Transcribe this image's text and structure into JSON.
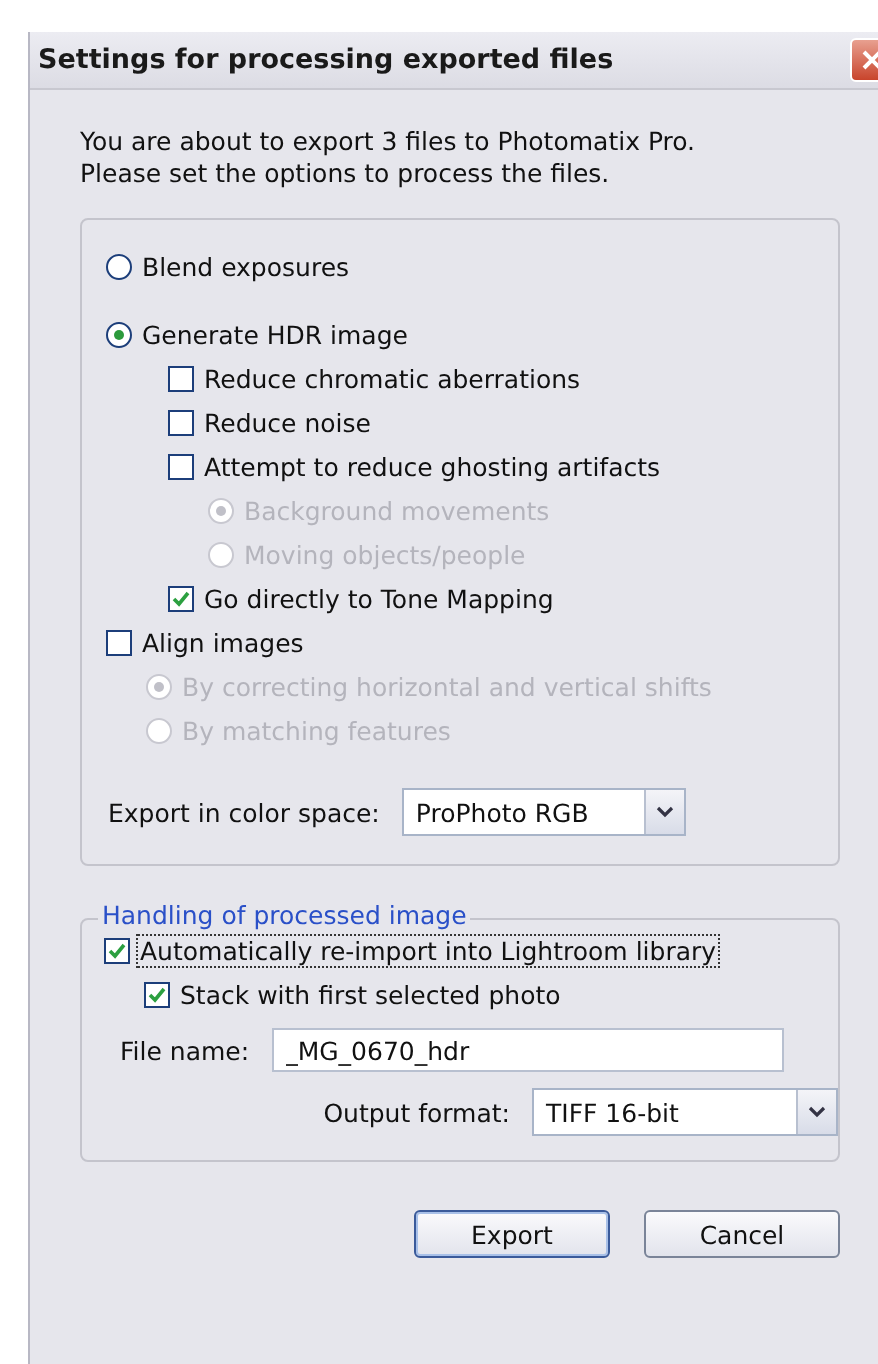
{
  "window": {
    "title": "Settings for processing exported files"
  },
  "intro_lines": [
    "You are about to export 3 files to Photomatix Pro.",
    "Please set the options to process the files."
  ],
  "processing": {
    "options": [
      {
        "kind": "radio",
        "label": "Blend exposures",
        "selected": false,
        "disabled": false
      },
      {
        "kind": "radio",
        "label": "Generate HDR image",
        "selected": true,
        "disabled": false,
        "children": [
          {
            "kind": "checkbox",
            "label": "Reduce chromatic aberrations",
            "checked": false,
            "disabled": false
          },
          {
            "kind": "checkbox",
            "label": "Reduce noise",
            "checked": false,
            "disabled": false
          },
          {
            "kind": "checkbox",
            "label": "Attempt to reduce ghosting artifacts",
            "checked": false,
            "disabled": false,
            "children": [
              {
                "kind": "radio",
                "label": "Background movements",
                "selected": true,
                "disabled": true
              },
              {
                "kind": "radio",
                "label": "Moving objects/people",
                "selected": false,
                "disabled": true
              }
            ]
          },
          {
            "kind": "checkbox",
            "label": "Go directly to Tone Mapping",
            "checked": true,
            "disabled": false
          }
        ]
      },
      {
        "kind": "checkbox",
        "label": "Align images",
        "checked": false,
        "disabled": false,
        "children": [
          {
            "kind": "radio",
            "label": "By correcting horizontal and vertical shifts",
            "selected": true,
            "disabled": true
          },
          {
            "kind": "radio",
            "label": "By matching features",
            "selected": false,
            "disabled": true
          }
        ]
      }
    ],
    "color_space": {
      "label": "Export in color space:",
      "value": "ProPhoto RGB"
    }
  },
  "handling": {
    "legend": "Handling of processed image",
    "options": [
      {
        "kind": "checkbox",
        "label": "Automatically re-import into Lightroom library",
        "checked": true,
        "disabled": false,
        "focused": true,
        "children": [
          {
            "kind": "checkbox",
            "label": "Stack with first selected photo",
            "checked": true,
            "disabled": false
          }
        ]
      }
    ],
    "file_name": {
      "label": "File name:",
      "value": "_MG_0670_hdr"
    },
    "output_format": {
      "label": "Output format:",
      "value": "TIFF 16-bit"
    }
  },
  "buttons": [
    {
      "label": "Export",
      "default": true
    },
    {
      "label": "Cancel",
      "default": false
    }
  ]
}
